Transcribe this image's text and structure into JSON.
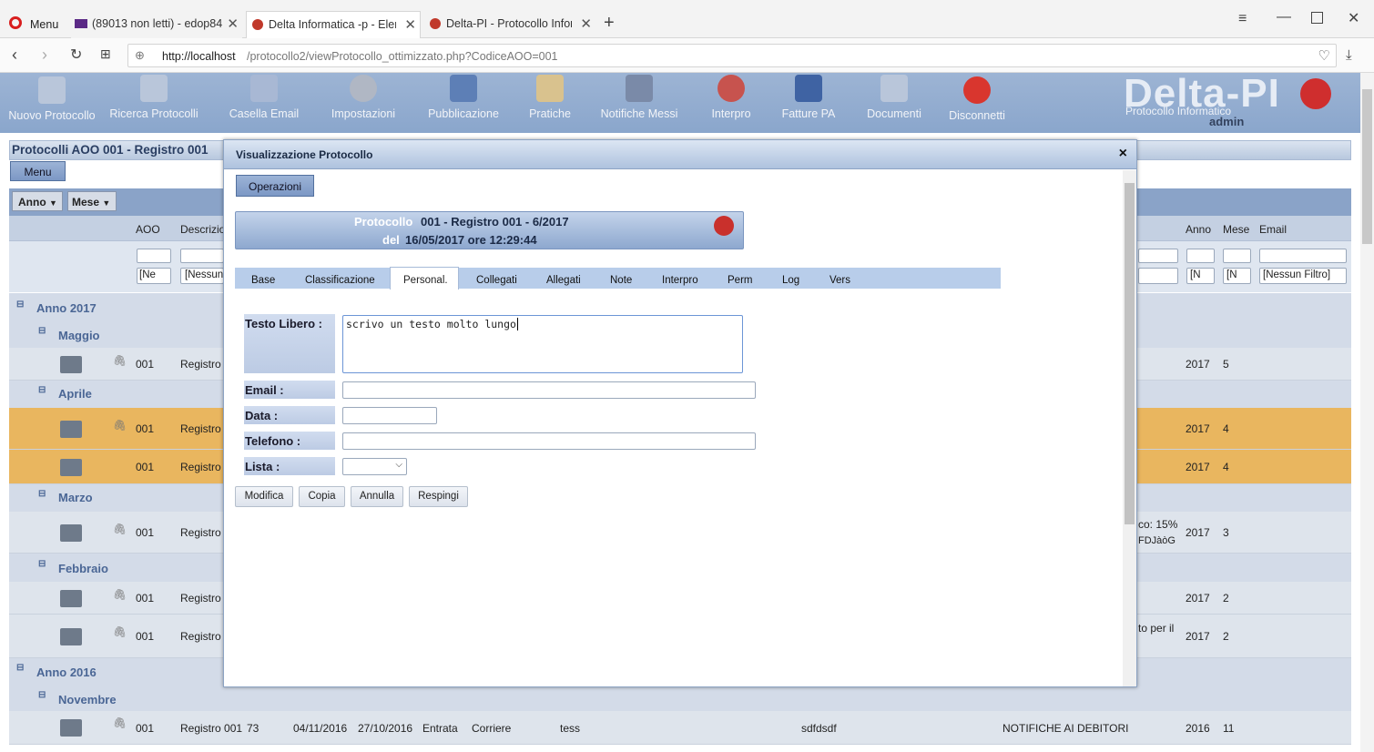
{
  "browser": {
    "menu_label": "Menu",
    "tabs": [
      {
        "label": "(89013 non letti) - edop84"
      },
      {
        "label": "Delta Informatica -p - Elen"
      },
      {
        "label": "Delta-PI - Protocollo Inform"
      }
    ],
    "url_host": "http://localhost",
    "url_path": "/protocollo2/viewProtocollo_ottimizzato.php?CodiceAOO=001"
  },
  "toolbar": {
    "items": [
      {
        "label": "Nuovo Protocollo"
      },
      {
        "label": "Ricerca Protocolli"
      },
      {
        "label": "Casella Email"
      },
      {
        "label": "Impostazioni"
      },
      {
        "label": "Pubblicazione"
      },
      {
        "label": "Pratiche"
      },
      {
        "label": "Notifiche Messi"
      },
      {
        "label": "Interpro"
      },
      {
        "label": "Fatture PA"
      },
      {
        "label": "Documenti"
      },
      {
        "label": "Disconnetti"
      }
    ],
    "logo_title": "Delta-PI",
    "logo_subtitle": "Protocollo Informatico",
    "user": "admin"
  },
  "page": {
    "title": "Protocolli AOO 001 - Registro 001",
    "menu_button": "Menu",
    "anno_select": "Anno",
    "mese_select": "Mese",
    "columns": {
      "aoo": "AOO",
      "descrizione": "Descrizio",
      "anno": "Anno",
      "mese": "Mese",
      "email": "Email"
    },
    "filters": {
      "ne": "[Ne",
      "nessun": "[Nessun",
      "n1": "[N",
      "n2": "[N",
      "email": "[Nessun Filtro]"
    },
    "groups": {
      "y2017": "Anno 2017",
      "maggio": "Maggio",
      "aprile": "Aprile",
      "marzo": "Marzo",
      "febbraio": "Febbraio",
      "y2016": "Anno 2016",
      "novembre": "Novembre"
    },
    "rows": {
      "r1": {
        "aoo": "001",
        "reg": "Registro (",
        "anno": "2017",
        "mese": "5"
      },
      "r2": {
        "aoo": "001",
        "reg": "Registro (",
        "anno": "2017",
        "mese": "4"
      },
      "r3": {
        "aoo": "001",
        "reg": "Registro (",
        "anno": "2017",
        "mese": "4"
      },
      "r4": {
        "aoo": "001",
        "reg": "Registro (",
        "anno": "2017",
        "mese": "3",
        "desc1": "co: 15%",
        "desc2": "FDJàòG"
      },
      "r5": {
        "aoo": "001",
        "reg": "Registro (",
        "anno": "2017",
        "mese": "2"
      },
      "r6": {
        "aoo": "001",
        "reg": "Registro (",
        "anno": "2017",
        "mese": "2",
        "desc1": "to per il"
      },
      "r7": {
        "aoo": "001",
        "reg": "Registro 001",
        "num": "73",
        "d1": "04/11/2016",
        "d2": "27/10/2016",
        "tipo": "Entrata",
        "mezzo": "Corriere",
        "ogg": "tess",
        "mitt": "sdfdsdf",
        "note": "NOTIFICHE AI DEBITORI",
        "anno": "2016",
        "mese": "11"
      }
    }
  },
  "modal": {
    "title": "Visualizzazione Protocollo",
    "close": "×",
    "operazioni": "Operazioni",
    "prot_label": "Protocollo",
    "prot_value": "001 - Registro 001 - 6/2017",
    "del_label": "del",
    "del_value": "16/05/2017 ore 12:29:44",
    "tabs": [
      "Base",
      "Classificazione",
      "Personal.",
      "Collegati",
      "Allegati",
      "Note",
      "Interpro",
      "Perm",
      "Log",
      "Vers"
    ],
    "fields": {
      "testo_label": "Testo Libero :",
      "testo_value": "scrivo un testo molto lungo",
      "email_label": "Email :",
      "data_label": "Data :",
      "telefono_label": "Telefono :",
      "lista_label": "Lista :"
    },
    "buttons": {
      "modifica": "Modifica",
      "copia": "Copia",
      "annulla": "Annulla",
      "respingi": "Respingi"
    }
  }
}
